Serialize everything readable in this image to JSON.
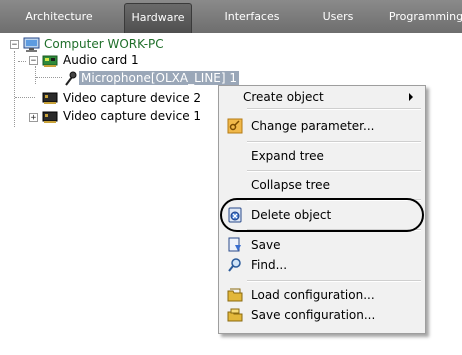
{
  "tabs": [
    {
      "label": "Architecture"
    },
    {
      "label": "Hardware"
    },
    {
      "label": "Interfaces"
    },
    {
      "label": "Users"
    },
    {
      "label": "Programming"
    }
  ],
  "active_tab": "Hardware",
  "tree": {
    "root": "Computer WORK-PC",
    "audio_card": "Audio card 1",
    "microphone": "Microphone[OLXA_LINE] 1",
    "video_device_2": "Video capture device 2",
    "video_device_1": "Video capture device 1"
  },
  "context_menu": {
    "create_object": "Create object",
    "change_parameter": "Change parameter...",
    "expand_tree": "Expand tree",
    "collapse_tree": "Collapse tree",
    "delete_object": "Delete object",
    "save": "Save",
    "find": "Find...",
    "load_configuration": "Load configuration...",
    "save_configuration": "Save configuration..."
  },
  "icons": {
    "computer": "computer-icon",
    "audio_card": "audio-card-icon",
    "microphone": "microphone-icon",
    "video_device": "video-device-icon",
    "change_parameter": "key-icon",
    "delete_object": "delete-object-icon",
    "save": "save-icon",
    "find": "magnifier-icon",
    "load": "load-folder-icon",
    "save_config": "save-folder-icon"
  },
  "colors": {
    "tab_bar": "#7a7a7a",
    "root_text": "#1f6f2a",
    "selection": "#9aa7b8",
    "menu_bg": "#f1f1f1"
  }
}
